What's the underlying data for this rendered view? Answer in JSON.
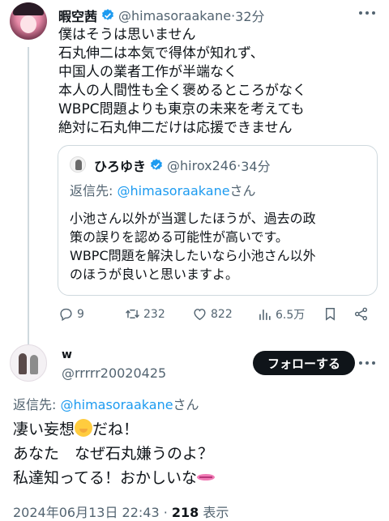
{
  "tweet": {
    "author_name": "暇空茜",
    "author_handle": "@himasoraakane",
    "time": "32分",
    "lines": [
      "僕はそうは思いません",
      "石丸伸二は本気で得体が知れず、",
      "中国人の業者工作が半端なく",
      "本人の人間性も全く褒めるところがなく",
      "WBPC問題よりも東京の未来を考えても",
      "絶対に石丸伸二だけは応援できません"
    ],
    "quote": {
      "author_name": "ひろゆき",
      "author_handle": "@hirox246",
      "time": "34分",
      "reply_prefix": "返信先: ",
      "reply_handle": "@himasoraakane",
      "reply_suffix": "さん",
      "lines": [
        "小池さん以外が当選したほうが、過去の政",
        "策の誤りを認める可能性が高いです。",
        "WBPC問題を解決したいなら小池さん以外",
        "のほうが良いと思いますよ。"
      ]
    },
    "actions": {
      "replies": "9",
      "retweets": "232",
      "likes": "822",
      "views": "6.5万"
    }
  },
  "reply": {
    "author_name": "w",
    "author_handle": "@rrrrr20020425",
    "follow_label": "フォローする",
    "reply_prefix": "返信先: ",
    "reply_handle": "@himasoraakane",
    "reply_suffix": "さん",
    "line1_a": "凄い妄想",
    "line1_b": "だね！",
    "line2": "あなた　なぜ石丸嫌うのよ？",
    "line3": "私達知ってる！おかしいな",
    "date": "2024年06月13日 22:43 · ",
    "views_count": "218",
    "views_label": " 表示"
  },
  "colors": {
    "accent": "#1d9bf0",
    "text": "#0f1419",
    "secondary": "#536471",
    "border": "#cfd9de"
  }
}
